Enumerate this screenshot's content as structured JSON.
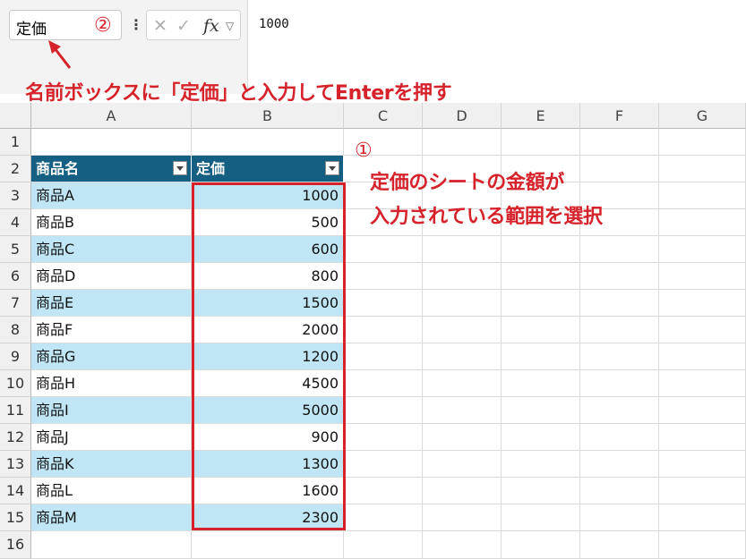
{
  "formula_bar": {
    "name_box_value": "定価",
    "marker_2": "②",
    "formula_value": "1000",
    "fx_label": "fx"
  },
  "annotations": {
    "top_instruction": "名前ボックスに「定価」と入力してEnterを押す",
    "marker_1": "①",
    "right_line1": "定価のシートの金額が",
    "right_line2": "入力されている範囲を選択"
  },
  "columns": [
    "A",
    "B",
    "C",
    "D",
    "E",
    "F",
    "G"
  ],
  "rows": [
    "1",
    "2",
    "3",
    "4",
    "5",
    "6",
    "7",
    "8",
    "9",
    "10",
    "11",
    "12",
    "13",
    "14",
    "15",
    "16"
  ],
  "table": {
    "headers": [
      "商品名",
      "定価"
    ],
    "data": [
      [
        "商品A",
        "1000"
      ],
      [
        "商品B",
        "500"
      ],
      [
        "商品C",
        "600"
      ],
      [
        "商品D",
        "800"
      ],
      [
        "商品E",
        "1500"
      ],
      [
        "商品F",
        "2000"
      ],
      [
        "商品G",
        "1200"
      ],
      [
        "商品H",
        "4500"
      ],
      [
        "商品I",
        "5000"
      ],
      [
        "商品J",
        "900"
      ],
      [
        "商品K",
        "1300"
      ],
      [
        "商品L",
        "1600"
      ],
      [
        "商品M",
        "2300"
      ]
    ]
  },
  "colors": {
    "header_fill": "#155f82",
    "band_fill": "#c0e6f5",
    "annotation": "#d6232b"
  }
}
